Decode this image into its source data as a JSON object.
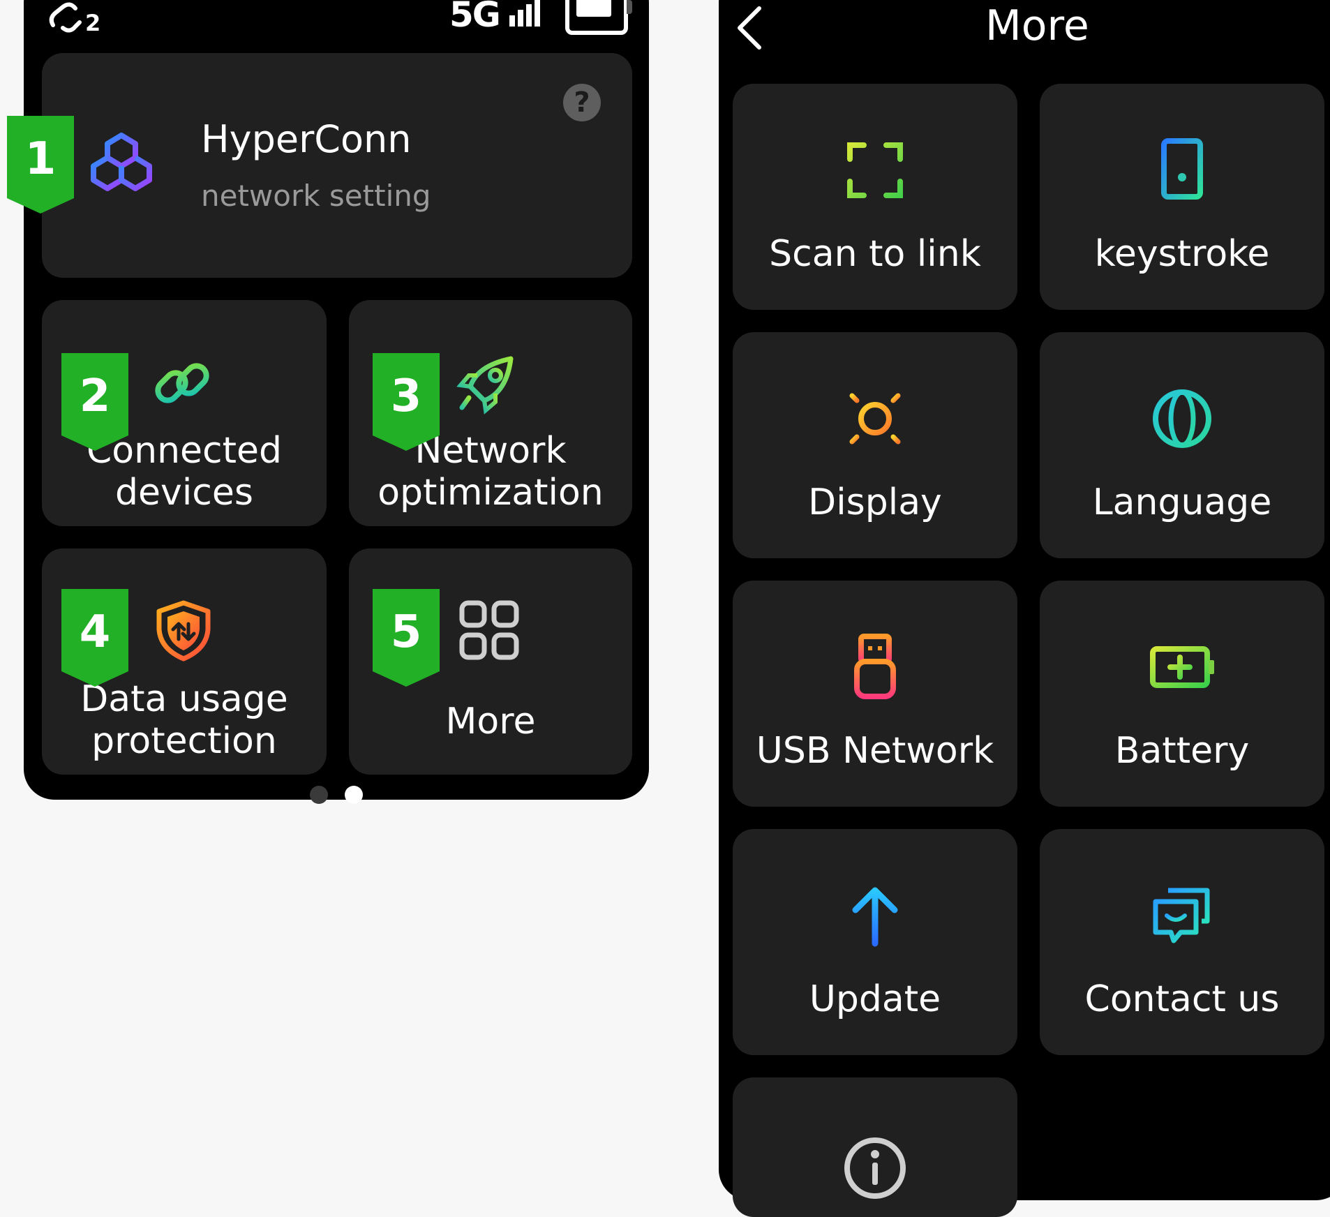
{
  "status_bar": {
    "link_count": "2",
    "network": "5G",
    "battery_level_fraction": 1.0
  },
  "home": {
    "hyperconn": {
      "title": "HyperConn",
      "subtitle": "network setting",
      "help": "?"
    },
    "tiles": [
      {
        "badge": "1"
      },
      {
        "badge": "2",
        "label_line1": "Connected",
        "label_line2": "devices"
      },
      {
        "badge": "3",
        "label_line1": "Network",
        "label_line2": "optimization"
      },
      {
        "badge": "4",
        "label_line1": "Data usage",
        "label_line2": "protection"
      },
      {
        "badge": "5",
        "label_line1": "More"
      }
    ],
    "page_indicator": {
      "pages": 2,
      "active_index": 1
    }
  },
  "more_screen": {
    "title": "More",
    "items": [
      {
        "label": "Scan to link",
        "icon": "scan-icon"
      },
      {
        "label": "keystroke",
        "icon": "keystroke-icon"
      },
      {
        "label": "Display",
        "icon": "sun-icon"
      },
      {
        "label": "Language",
        "icon": "globe-icon"
      },
      {
        "label": "USB Network",
        "icon": "usb-icon"
      },
      {
        "label": "Battery",
        "icon": "battery-icon"
      },
      {
        "label": "Update",
        "icon": "arrow-up-icon"
      },
      {
        "label": "Contact us",
        "icon": "chat-icon"
      },
      {
        "label": "",
        "icon": "info-icon"
      }
    ]
  },
  "colors": {
    "badge_green": "#22b126",
    "card_bg": "#202020",
    "screen_bg": "#000000",
    "page_bg": "#f7f7f7"
  }
}
